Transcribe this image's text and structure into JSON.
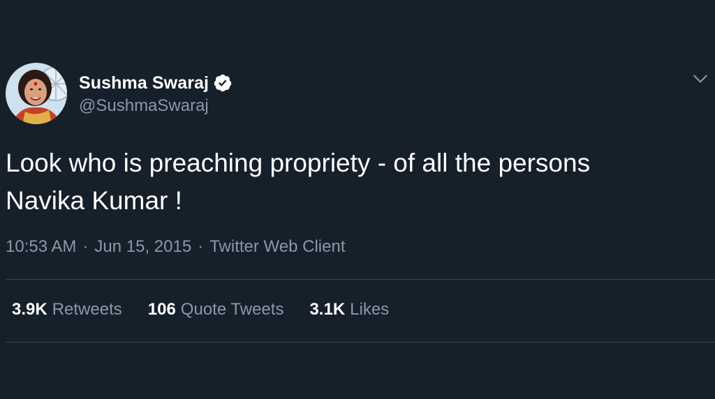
{
  "user": {
    "display_name": "Sushma Swaraj",
    "handle": "@SushmaSwaraj",
    "verified": true,
    "avatar_icon": "profile-photo"
  },
  "tweet": {
    "lines": [
      "Look who is preaching propriety - of all the persons",
      "Navika Kumar !"
    ],
    "time": "10:53 AM",
    "separator": "·",
    "date": "Jun 15, 2015",
    "client": "Twitter Web Client"
  },
  "stats": {
    "retweets_count": "3.9K",
    "retweets_label": "Retweets",
    "quotes_count": "106",
    "quotes_label": "Quote Tweets",
    "likes_count": "3.1K",
    "likes_label": "Likes"
  },
  "colors": {
    "background": "#15202b",
    "text_primary": "#ffffff",
    "text_secondary": "#8899a6",
    "divider": "#38444d"
  },
  "icons": {
    "verified": "verified-badge-icon",
    "menu": "chevron-down-icon"
  }
}
